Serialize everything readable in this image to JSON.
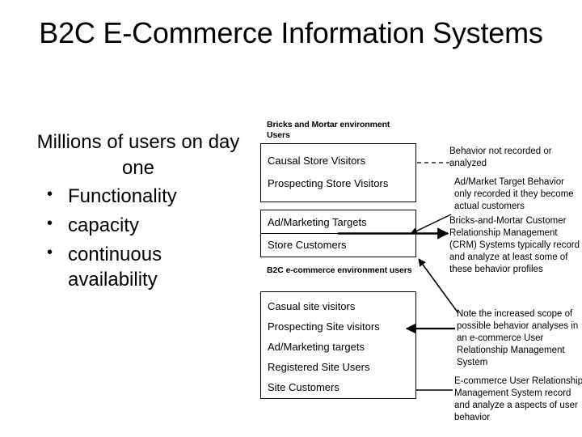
{
  "slide": {
    "title": "B2C E-Commerce Information Systems"
  },
  "left_body": {
    "lead": "Millions of users on day one",
    "bullet_marker": "•",
    "bullets": [
      "Functionality",
      "capacity",
      "continuous availability"
    ]
  },
  "diagram": {
    "group_labels": {
      "bricks": "Bricks and Mortar environment Users",
      "b2c": "B2C e-commerce environment users"
    },
    "box_bricks_visitors": {
      "rows": [
        "Causal Store Visitors",
        "Prospecting Store Visitors"
      ]
    },
    "box_bricks_customers": {
      "rows": [
        "Ad/Marketing Targets",
        "Store Customers"
      ]
    },
    "box_b2c_users": {
      "rows": [
        "Casual site visitors",
        "Prospecting Site visitors",
        "Ad/Marketing targets",
        "Registered Site Users",
        "Site Customers"
      ]
    },
    "notes": {
      "not_recorded": "Behavior not recorded or analyzed",
      "ad_target": "Ad/Market Target Behavior only recorded it they become actual customers",
      "crm": "Bricks-and-Mortar Customer Relationship Management (CRM) Systems typically record and analyze at least some of these behavior profiles",
      "increased_scope": "Note the increased scope of possible behavior analyses in an e-commerce User Relationship Management System",
      "ecommerce_urm": "E-commerce User Relationship Management System record and analyze a aspects of user behavior"
    }
  },
  "colors": {
    "background": "#ffffff",
    "ink": "#000000"
  }
}
